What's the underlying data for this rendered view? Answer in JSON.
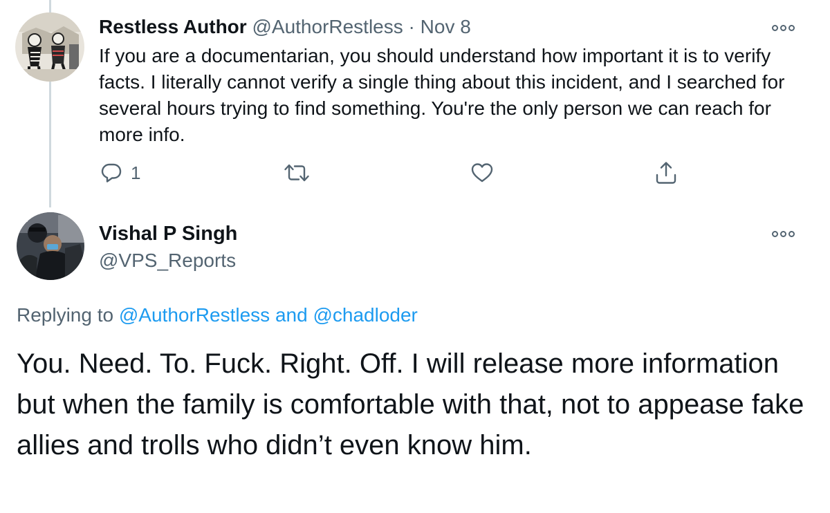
{
  "tweet1": {
    "author_name": "Restless Author",
    "handle": "@AuthorRestless",
    "separator": "·",
    "date": "Nov 8",
    "text": "If you are a documentarian, you should understand how important it is to verify facts. I literally cannot verify a single thing about this incident, and I searched for several hours trying to find something. You're the only person we can reach for more info.",
    "reply_count": "1",
    "icons": {
      "reply": "reply-icon",
      "retweet": "retweet-icon",
      "like": "heart-icon",
      "share": "share-icon",
      "more": "more-icon"
    }
  },
  "tweet2": {
    "author_name": "Vishal P Singh",
    "handle": "@VPS_Reports",
    "replying_prefix": "Replying to",
    "replying_user1": "@AuthorRestless",
    "replying_and": "and",
    "replying_user2": "@chadloder",
    "text": "You. Need. To. Fuck. Right. Off. I will release more information but when the family is comfortable with that, not to appease fake allies and trolls who didn’t even know him."
  },
  "colors": {
    "text": "#0f1419",
    "secondary": "#536471",
    "link": "#1d9bf0",
    "thread_line": "#cfd9de"
  }
}
